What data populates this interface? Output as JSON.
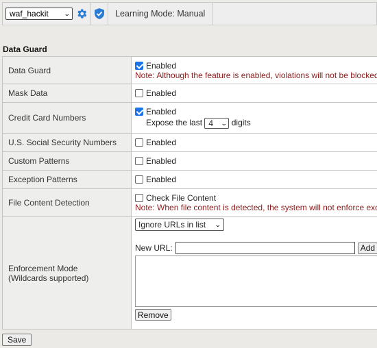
{
  "toolbar": {
    "policy_value": "waf_hackit",
    "mode_text": "Learning Mode: Manual"
  },
  "section_title": "Data Guard",
  "rows": {
    "data_guard": {
      "label": "Data Guard",
      "checkbox_label": "Enabled",
      "checked": true,
      "note": "Note: Although the feature is enabled, violations will not be blocked"
    },
    "mask_data": {
      "label": "Mask Data",
      "checkbox_label": "Enabled",
      "checked": false
    },
    "credit_card": {
      "label": "Credit Card Numbers",
      "checkbox_label": "Enabled",
      "checked": true,
      "expose_prefix": "Expose the last",
      "expose_value": "4",
      "expose_suffix": "digits"
    },
    "ssn": {
      "label": "U.S. Social Security Numbers",
      "checkbox_label": "Enabled",
      "checked": false
    },
    "custom_patterns": {
      "label": "Custom Patterns",
      "checkbox_label": "Enabled",
      "checked": false
    },
    "exception_patterns": {
      "label": "Exception Patterns",
      "checkbox_label": "Enabled",
      "checked": false
    },
    "file_content": {
      "label": "File Content Detection",
      "checkbox_label": "Check File Content",
      "checked": false,
      "note": "Note: When file content is detected, the system will not enforce exc"
    },
    "enforcement": {
      "label_line1": "Enforcement Mode",
      "label_line2": "(Wildcards supported)",
      "mode_value": "Ignore URLs in list",
      "new_url_label": "New URL:",
      "new_url_value": "",
      "add_label": "Add",
      "remove_label": "Remove"
    }
  },
  "save_label": "Save",
  "colors": {
    "checkbox_accent": "#1a73e8",
    "note_text": "#8b1a1a",
    "label_bg": "#eeeeec"
  }
}
